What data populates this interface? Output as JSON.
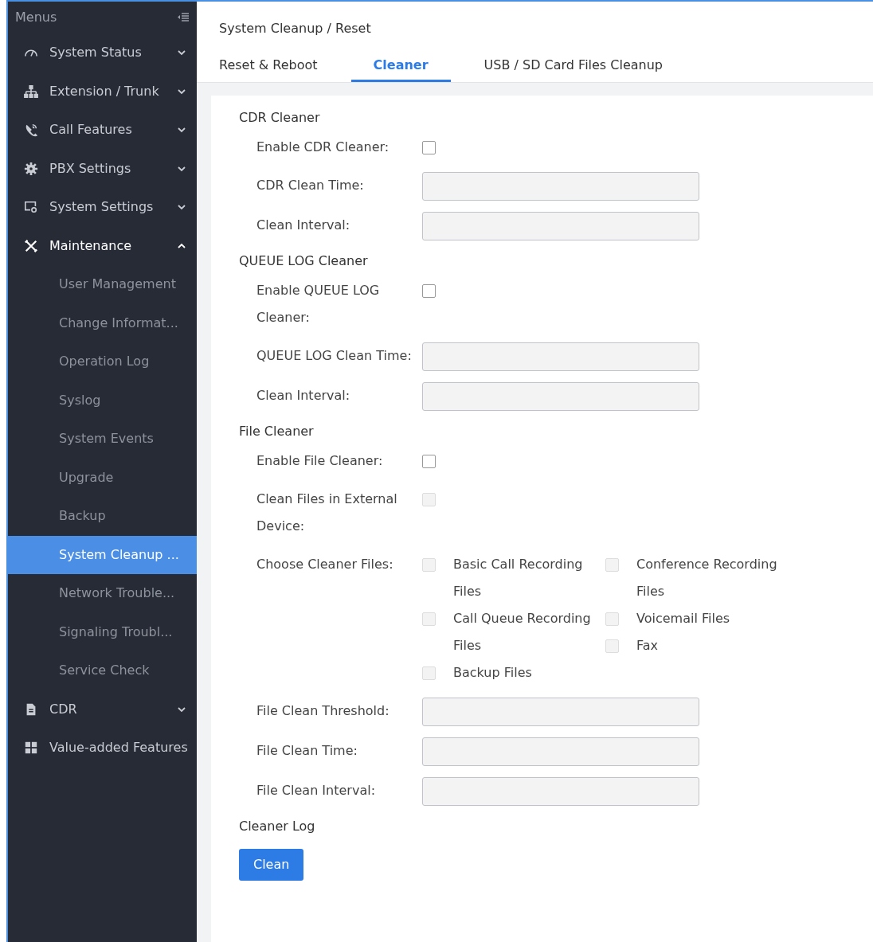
{
  "sidebar": {
    "title": "Menus",
    "items": [
      {
        "label": "System Status",
        "expanded": false
      },
      {
        "label": "Extension / Trunk",
        "expanded": false
      },
      {
        "label": "Call Features",
        "expanded": false
      },
      {
        "label": "PBX Settings",
        "expanded": false
      },
      {
        "label": "System Settings",
        "expanded": false
      },
      {
        "label": "Maintenance",
        "expanded": true,
        "children": [
          {
            "label": "User Management",
            "selected": false
          },
          {
            "label": "Change Informat...",
            "selected": false
          },
          {
            "label": "Operation Log",
            "selected": false
          },
          {
            "label": "Syslog",
            "selected": false
          },
          {
            "label": "System Events",
            "selected": false
          },
          {
            "label": "Upgrade",
            "selected": false
          },
          {
            "label": "Backup",
            "selected": false
          },
          {
            "label": "System Cleanup ...",
            "selected": true
          },
          {
            "label": "Network Trouble...",
            "selected": false
          },
          {
            "label": "Signaling Troubl...",
            "selected": false
          },
          {
            "label": "Service Check",
            "selected": false
          }
        ]
      },
      {
        "label": "CDR",
        "expanded": false
      },
      {
        "label": "Value-added Features"
      }
    ]
  },
  "breadcrumb": "System Cleanup / Reset",
  "tabs": [
    {
      "label": "Reset & Reboot",
      "selected": false
    },
    {
      "label": "Cleaner",
      "selected": true
    },
    {
      "label": "USB / SD Card Files Cleanup",
      "selected": false
    }
  ],
  "sections": [
    {
      "title": "CDR Cleaner",
      "fields": [
        {
          "kind": "checkbox",
          "label": "Enable CDR Cleaner:",
          "checked": false,
          "disabled": false
        },
        {
          "kind": "text",
          "label": "CDR Clean Time:",
          "disabled": true
        },
        {
          "kind": "text",
          "label": "Clean Interval:",
          "disabled": true
        }
      ]
    },
    {
      "title": "QUEUE LOG Cleaner",
      "fields": [
        {
          "kind": "checkbox",
          "label": "Enable QUEUE LOG Cleaner:",
          "checked": false,
          "disabled": false
        },
        {
          "kind": "text",
          "label": "QUEUE LOG Clean Time:",
          "disabled": true
        },
        {
          "kind": "text",
          "label": "Clean Interval:",
          "disabled": true
        }
      ]
    },
    {
      "title": "File Cleaner",
      "fields": [
        {
          "kind": "checkbox",
          "label": "Enable File Cleaner:",
          "checked": false,
          "disabled": false
        },
        {
          "kind": "checkbox",
          "label": "Clean Files in External Device:",
          "checked": false,
          "disabled": true
        },
        {
          "kind": "checkgroup",
          "label": "Choose Cleaner Files:",
          "columns": [
            [
              {
                "label": "Basic Call Recording Files",
                "checked": false,
                "disabled": true
              },
              {
                "label": "Call Queue Recording Files",
                "checked": false,
                "disabled": true
              },
              {
                "label": "Backup Files",
                "checked": false,
                "disabled": true
              }
            ],
            [
              {
                "label": "Conference Recording Files",
                "checked": false,
                "disabled": true
              },
              {
                "label": "Voicemail Files",
                "checked": false,
                "disabled": true
              },
              {
                "label": "Fax",
                "checked": false,
                "disabled": true
              }
            ]
          ]
        },
        {
          "kind": "text",
          "label": "File Clean Threshold:",
          "disabled": true
        },
        {
          "kind": "text",
          "label": "File Clean Time:",
          "disabled": true
        },
        {
          "kind": "text",
          "label": "File Clean Interval:",
          "disabled": true
        }
      ]
    },
    {
      "title": "Cleaner Log"
    }
  ],
  "button": "Clean"
}
